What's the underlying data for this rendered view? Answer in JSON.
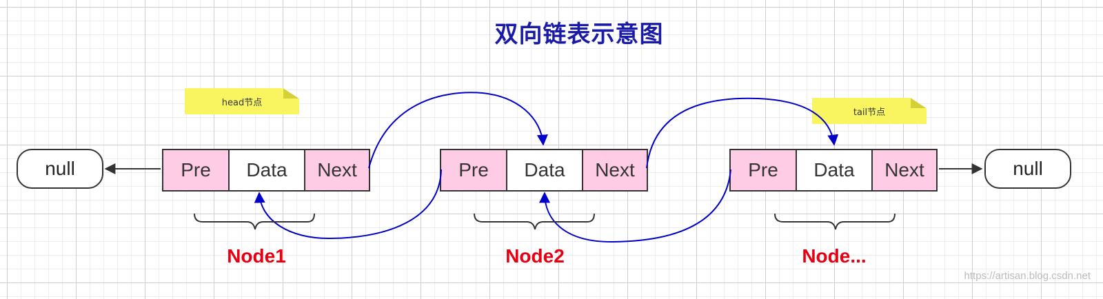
{
  "title": "双向链表示意图",
  "colors": {
    "title": "#1a1aa8",
    "pointer_cell": "#ffcce6",
    "data_cell": "#ffffff",
    "note": "#f8f560",
    "arrow": "#0000c8",
    "node_label": "#e60012"
  },
  "null_left": "null",
  "null_right": "null",
  "nodes": [
    {
      "pre": "Pre",
      "data": "Data",
      "next": "Next",
      "label": "Node1"
    },
    {
      "pre": "Pre",
      "data": "Data",
      "next": "Next",
      "label": "Node2"
    },
    {
      "pre": "Pre",
      "data": "Data",
      "next": "Next",
      "label": "Node..."
    }
  ],
  "notes": {
    "head": "head节点",
    "tail": "tail节点"
  },
  "watermark": "https://artisan.blog.csdn.net"
}
